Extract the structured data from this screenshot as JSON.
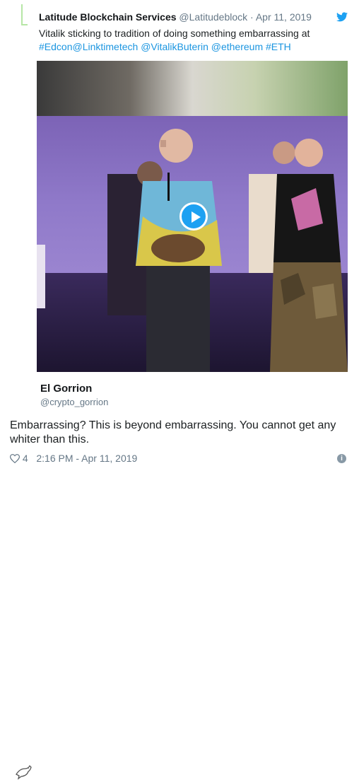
{
  "quoted_tweet": {
    "author_name": "Latitude Blockchain Services",
    "author_handle": "@Latitudeblock",
    "separator": "·",
    "date": "Apr 11, 2019",
    "text_plain": "Vitalik sticking to tradition of doing something embarrassing at",
    "links": [
      "#Edcon",
      "@Linktimetech",
      "@VitalikButerin",
      "@ethereum",
      "#ETH"
    ],
    "media_type": "video"
  },
  "reply": {
    "author_name": "El Gorrion",
    "author_handle": "@crypto_gorrion",
    "text": "Embarrassing? This is beyond embarrassing. You cannot get any whiter than this.",
    "like_count": "4",
    "timestamp": "2:16 PM - Apr 11, 2019"
  },
  "icons": {
    "brand": "twitter-bird-icon",
    "play": "play-icon",
    "like": "heart-icon",
    "info": "info-icon"
  },
  "colors": {
    "link": "#1b95e0",
    "brand": "#1da1f2",
    "thread": "#b6e6a6",
    "muted": "#657786"
  }
}
